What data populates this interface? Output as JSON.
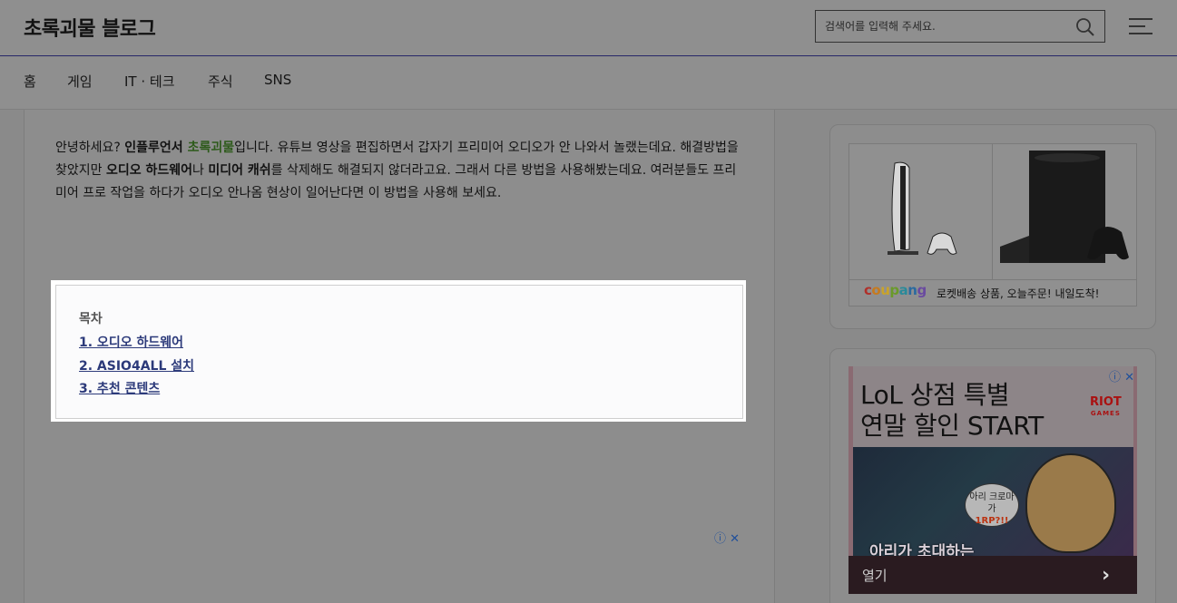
{
  "header": {
    "site_title": "초록괴물 블로그",
    "search_placeholder": "검색어를 입력해 주세요."
  },
  "nav": {
    "items": [
      "홈",
      "게임",
      "IT · 테크",
      "주식",
      "SNS"
    ]
  },
  "article": {
    "intro_parts": {
      "p1": "안녕하세요? ",
      "p2_bold": "인플루언서 ",
      "p3_green": "초록괴물",
      "p4": "입니다. 유튜브 영상을 편집하면서 갑자기 프리미어 오디오가 안 나와서 놀랬는데요. 해결방법을 찾았지만 ",
      "p5_bold": "오디오 하드웨어",
      "p6": "나 ",
      "p7_bold": "미디어 캐쉬",
      "p8": "를 삭제해도 해결되지 않더라고요. 그래서 다른 방법을 사용해봤는데요. 여러분들도 프리미어 프로 작업을 하다가 오디오 안나옴 현상이 일어난다면 이 방법을 사용해 보세요."
    },
    "toc": {
      "title": "목차",
      "links": [
        "1. 오디오 하드웨어",
        "2. ASIO4ALL 설치",
        "3. 추천 콘텐츠"
      ]
    },
    "ad_choice": "ⓘ ✕"
  },
  "sidebar": {
    "coupang": {
      "logo": "coupang",
      "text": "로켓배송 상품, 오늘주문! 내일도착!"
    },
    "ad": {
      "headline_1": "LoL 상점 특별",
      "headline_2": "연말 할인 START",
      "brand": "RIOT",
      "brand_sub": "GAMES",
      "bubble_1": "아리 크로마가",
      "bubble_2": "1RP?!!",
      "art_text": "아리가 초대하는",
      "open_label": "열기",
      "chevron": "›",
      "ad_choice": "ⓘ ✕"
    }
  },
  "colors": {
    "toc_link": "#2c3a7a",
    "green_name": "#2d5a1a",
    "coupang_red": "#b0302a",
    "coupang_orange": "#c77a1e",
    "coupang_green": "#6a9a2a",
    "coupang_blue": "#2a6aa0"
  }
}
